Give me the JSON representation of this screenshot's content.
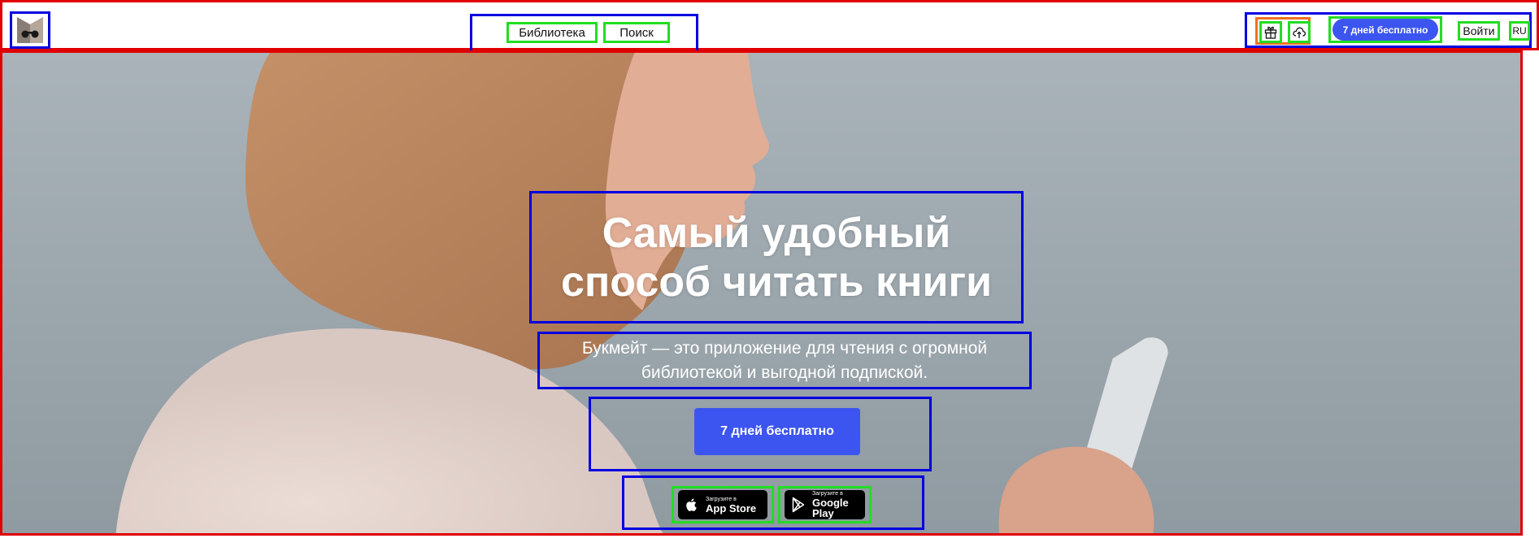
{
  "header": {
    "logo_icon": "bookmate-logo-icon",
    "nav": {
      "library": "Библиотека",
      "search": "Поиск"
    },
    "actions": {
      "gift_icon": "gift-icon",
      "upload_icon": "cloud-upload-icon",
      "trial_button": "7 дней бесплатно",
      "login": "Войти",
      "language": "RU"
    }
  },
  "hero": {
    "title": "Самый удобный способ читать книги",
    "subtitle": "Букмейт — это приложение для чтения с огромной библиотекой и выгодной подпиской.",
    "cta": "7 дней бесплатно",
    "stores": {
      "appstore": {
        "small": "Загрузите в",
        "big": "App Store",
        "icon": "apple-icon"
      },
      "gplay": {
        "small": "Загрузите в",
        "big": "Google Play",
        "icon": "google-play-icon"
      }
    }
  },
  "colors": {
    "accent": "#3c55f0",
    "header_bg": "#ffffff",
    "hero_text": "#ffffff"
  }
}
